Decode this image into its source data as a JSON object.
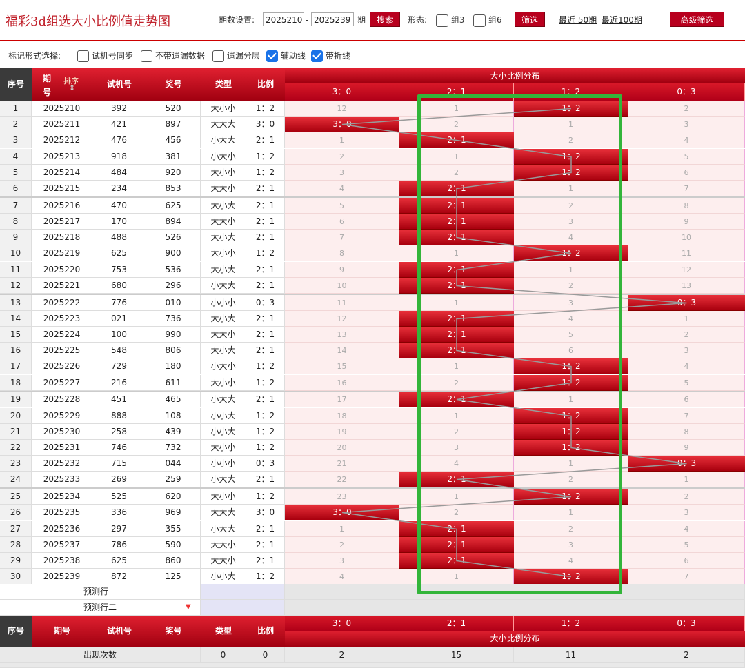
{
  "header": {
    "title": "福彩3d组选大小比例值走势图",
    "period_label": "期数设置:",
    "period_start": "2025210",
    "period_sep": "-",
    "period_end": "2025239",
    "period_unit": "期",
    "search_label": "搜索",
    "form_label": "形态:",
    "group3_label": "组3",
    "group6_label": "组6",
    "filter_label": "筛选",
    "recent50_label": "最近 50期",
    "recent100_label": "最近100期",
    "advanced_label": "高级筛选"
  },
  "markbar": {
    "label": "标记形式选择:",
    "opt1": "试机号同步",
    "opt2": "不带遗漏数据",
    "opt3": "遗漏分层",
    "opt4": "辅助线",
    "opt5": "带折线"
  },
  "table": {
    "headers": {
      "seq": "序号",
      "period_top": "期",
      "period_bottom": "号",
      "sort": "排序",
      "trial": "试机号",
      "draw": "奖号",
      "type": "类型",
      "ratio": "比例",
      "dist_title": "大小比例分布",
      "cols": [
        "3：0",
        "2：1",
        "1：2",
        "0：3"
      ]
    },
    "rows": [
      {
        "n": "1",
        "p": "2025210",
        "t": "392",
        "d": "520",
        "ty": "大小小",
        "r": "1：2",
        "hit": 2,
        "v": [
          "12",
          "1",
          "1：2",
          "2"
        ]
      },
      {
        "n": "2",
        "p": "2025211",
        "t": "421",
        "d": "897",
        "ty": "大大大",
        "r": "3：0",
        "hit": 0,
        "v": [
          "3：0",
          "2",
          "1",
          "3"
        ]
      },
      {
        "n": "3",
        "p": "2025212",
        "t": "476",
        "d": "456",
        "ty": "小大大",
        "r": "2：1",
        "hit": 1,
        "v": [
          "1",
          "2：1",
          "2",
          "4"
        ]
      },
      {
        "n": "4",
        "p": "2025213",
        "t": "918",
        "d": "381",
        "ty": "小大小",
        "r": "1：2",
        "hit": 2,
        "v": [
          "2",
          "1",
          "1：2",
          "5"
        ]
      },
      {
        "n": "5",
        "p": "2025214",
        "t": "484",
        "d": "920",
        "ty": "大小小",
        "r": "1：2",
        "hit": 2,
        "v": [
          "3",
          "2",
          "1：2",
          "6"
        ]
      },
      {
        "n": "6",
        "p": "2025215",
        "t": "234",
        "d": "853",
        "ty": "大大小",
        "r": "2：1",
        "hit": 1,
        "v": [
          "4",
          "2：1",
          "1",
          "7"
        ]
      },
      {
        "n": "7",
        "p": "2025216",
        "t": "470",
        "d": "625",
        "ty": "大小大",
        "r": "2：1",
        "hit": 1,
        "v": [
          "5",
          "2：1",
          "2",
          "8"
        ]
      },
      {
        "n": "8",
        "p": "2025217",
        "t": "170",
        "d": "894",
        "ty": "大大小",
        "r": "2：1",
        "hit": 1,
        "v": [
          "6",
          "2：1",
          "3",
          "9"
        ]
      },
      {
        "n": "9",
        "p": "2025218",
        "t": "488",
        "d": "526",
        "ty": "大小大",
        "r": "2：1",
        "hit": 1,
        "v": [
          "7",
          "2：1",
          "4",
          "10"
        ]
      },
      {
        "n": "10",
        "p": "2025219",
        "t": "625",
        "d": "900",
        "ty": "大小小",
        "r": "1：2",
        "hit": 2,
        "v": [
          "8",
          "1",
          "1：2",
          "11"
        ]
      },
      {
        "n": "11",
        "p": "2025220",
        "t": "753",
        "d": "536",
        "ty": "大小大",
        "r": "2：1",
        "hit": 1,
        "v": [
          "9",
          "2：1",
          "1",
          "12"
        ]
      },
      {
        "n": "12",
        "p": "2025221",
        "t": "680",
        "d": "296",
        "ty": "小大大",
        "r": "2：1",
        "hit": 1,
        "v": [
          "10",
          "2：1",
          "2",
          "13"
        ]
      },
      {
        "n": "13",
        "p": "2025222",
        "t": "776",
        "d": "010",
        "ty": "小小小",
        "r": "0：3",
        "hit": 3,
        "v": [
          "11",
          "1",
          "3",
          "0：3"
        ]
      },
      {
        "n": "14",
        "p": "2025223",
        "t": "021",
        "d": "736",
        "ty": "大小大",
        "r": "2：1",
        "hit": 1,
        "v": [
          "12",
          "2：1",
          "4",
          "1"
        ]
      },
      {
        "n": "15",
        "p": "2025224",
        "t": "100",
        "d": "990",
        "ty": "大大小",
        "r": "2：1",
        "hit": 1,
        "v": [
          "13",
          "2：1",
          "5",
          "2"
        ]
      },
      {
        "n": "16",
        "p": "2025225",
        "t": "548",
        "d": "806",
        "ty": "大小大",
        "r": "2：1",
        "hit": 1,
        "v": [
          "14",
          "2：1",
          "6",
          "3"
        ]
      },
      {
        "n": "17",
        "p": "2025226",
        "t": "729",
        "d": "180",
        "ty": "小大小",
        "r": "1：2",
        "hit": 2,
        "v": [
          "15",
          "1",
          "1：2",
          "4"
        ]
      },
      {
        "n": "18",
        "p": "2025227",
        "t": "216",
        "d": "611",
        "ty": "大小小",
        "r": "1：2",
        "hit": 2,
        "v": [
          "16",
          "2",
          "1：2",
          "5"
        ]
      },
      {
        "n": "19",
        "p": "2025228",
        "t": "451",
        "d": "465",
        "ty": "小大大",
        "r": "2：1",
        "hit": 1,
        "v": [
          "17",
          "2：1",
          "1",
          "6"
        ]
      },
      {
        "n": "20",
        "p": "2025229",
        "t": "888",
        "d": "108",
        "ty": "小小大",
        "r": "1：2",
        "hit": 2,
        "v": [
          "18",
          "1",
          "1：2",
          "7"
        ]
      },
      {
        "n": "21",
        "p": "2025230",
        "t": "258",
        "d": "439",
        "ty": "小小大",
        "r": "1：2",
        "hit": 2,
        "v": [
          "19",
          "2",
          "1：2",
          "8"
        ]
      },
      {
        "n": "22",
        "p": "2025231",
        "t": "746",
        "d": "732",
        "ty": "大小小",
        "r": "1：2",
        "hit": 2,
        "v": [
          "20",
          "3",
          "1：2",
          "9"
        ]
      },
      {
        "n": "23",
        "p": "2025232",
        "t": "715",
        "d": "044",
        "ty": "小小小",
        "r": "0：3",
        "hit": 3,
        "v": [
          "21",
          "4",
          "1",
          "0：3"
        ]
      },
      {
        "n": "24",
        "p": "2025233",
        "t": "269",
        "d": "259",
        "ty": "小大大",
        "r": "2：1",
        "hit": 1,
        "v": [
          "22",
          "2：1",
          "2",
          "1"
        ]
      },
      {
        "n": "25",
        "p": "2025234",
        "t": "525",
        "d": "620",
        "ty": "大小小",
        "r": "1：2",
        "hit": 2,
        "v": [
          "23",
          "1",
          "1：2",
          "2"
        ]
      },
      {
        "n": "26",
        "p": "2025235",
        "t": "336",
        "d": "969",
        "ty": "大大大",
        "r": "3：0",
        "hit": 0,
        "v": [
          "3：0",
          "2",
          "1",
          "3"
        ]
      },
      {
        "n": "27",
        "p": "2025236",
        "t": "297",
        "d": "355",
        "ty": "小大大",
        "r": "2：1",
        "hit": 1,
        "v": [
          "1",
          "2：1",
          "2",
          "4"
        ]
      },
      {
        "n": "28",
        "p": "2025237",
        "t": "786",
        "d": "590",
        "ty": "大大小",
        "r": "2：1",
        "hit": 1,
        "v": [
          "2",
          "2：1",
          "3",
          "5"
        ]
      },
      {
        "n": "29",
        "p": "2025238",
        "t": "625",
        "d": "860",
        "ty": "大大小",
        "r": "2：1",
        "hit": 1,
        "v": [
          "3",
          "2：1",
          "4",
          "6"
        ]
      },
      {
        "n": "30",
        "p": "2025239",
        "t": "872",
        "d": "125",
        "ty": "小小大",
        "r": "1：2",
        "hit": 2,
        "v": [
          "4",
          "1",
          "1：2",
          "7"
        ]
      }
    ],
    "predict1": "预测行一",
    "predict2": "预测行二",
    "stats_label": "出现次数",
    "stats": [
      "0",
      "0",
      "2",
      "15",
      "11",
      "2"
    ]
  },
  "colors": {
    "brand_red": "#b8001e",
    "highlight_green": "#33b53a"
  }
}
